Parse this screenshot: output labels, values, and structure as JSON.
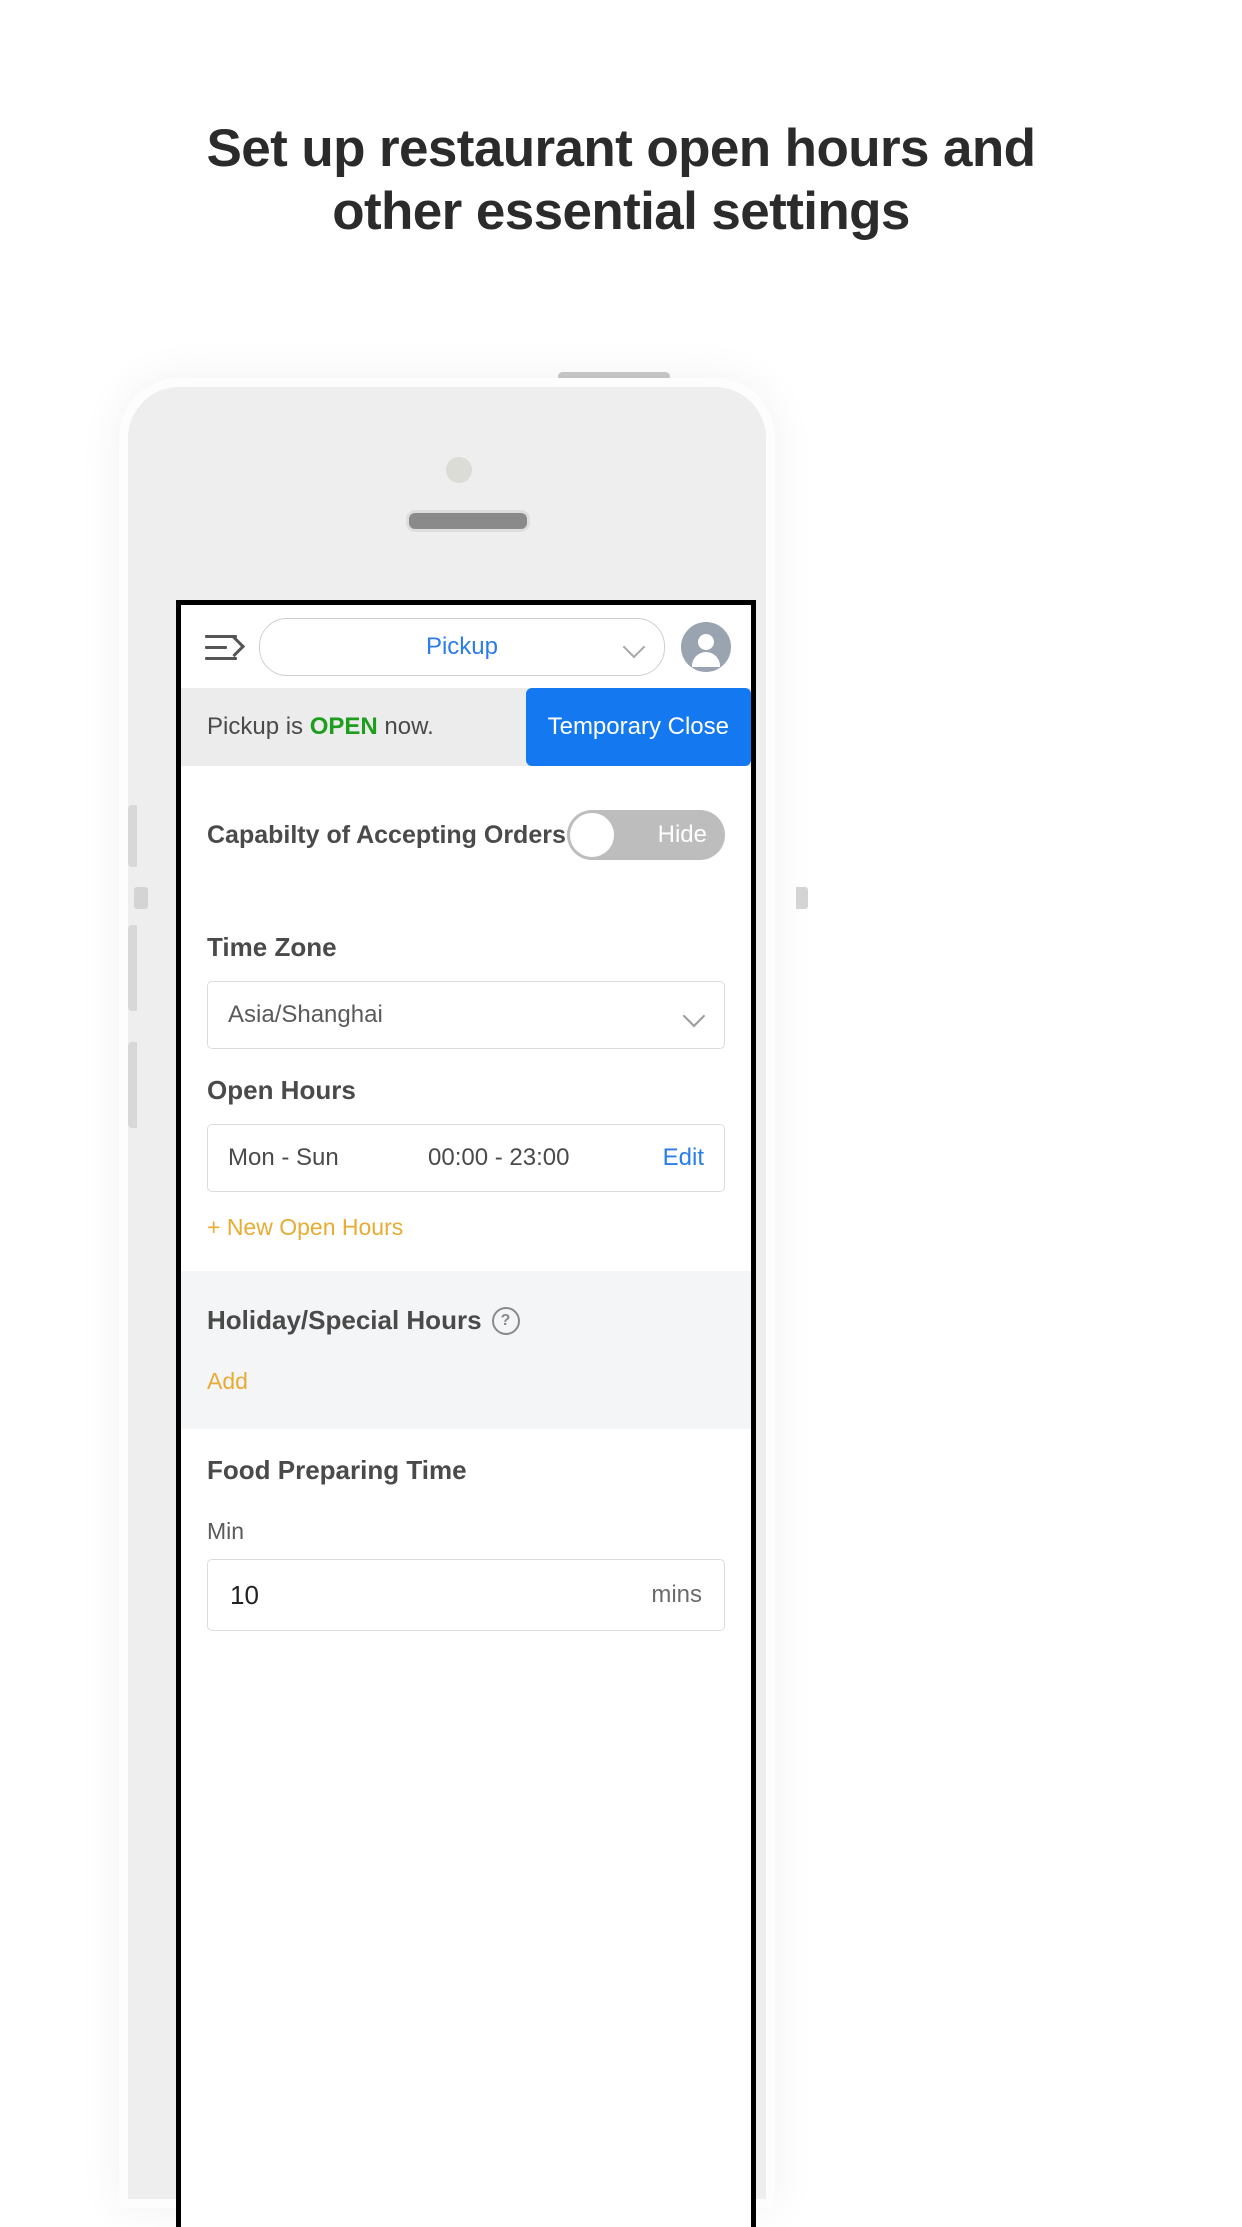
{
  "headline": {
    "line1": "Set up restaurant open hours and",
    "line2": "other essential settings"
  },
  "colors": {
    "accent_blue": "#1478f0",
    "link_blue": "#2b7de9",
    "open_green": "#1f9d1f",
    "amber": "#e8ab33",
    "toggle_off_gray": "#bdbdbd"
  },
  "app": {
    "appbar": {
      "menu_icon": "menu-unfold-icon",
      "mode_selector": {
        "value": "Pickup",
        "chevron": "chevron-down-icon"
      },
      "avatar": "user-avatar-icon"
    },
    "status_strip": {
      "prefix": "Pickup is ",
      "state": "OPEN",
      "suffix": " now.",
      "button_label": "Temporary Close"
    },
    "capability": {
      "label": "Capabilty of Accepting Orders",
      "toggle_label": "Hide",
      "toggle_state": "off"
    },
    "time_zone": {
      "title": "Time Zone",
      "value": "Asia/Shanghai"
    },
    "open_hours": {
      "title": "Open Hours",
      "rows": [
        {
          "days": "Mon - Sun",
          "time": "00:00 - 23:00",
          "action": "Edit"
        }
      ],
      "add_link": "+ New Open Hours"
    },
    "holiday_hours": {
      "title": "Holiday/Special Hours",
      "help_icon": "question-mark-icon",
      "help_glyph": "?",
      "add_link": "Add"
    },
    "food_preparing_time": {
      "title": "Food Preparing Time",
      "min_label": "Min",
      "min_value": "10",
      "min_unit": "mins"
    }
  }
}
